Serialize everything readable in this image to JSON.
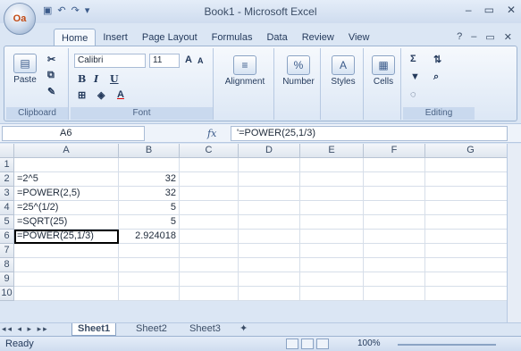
{
  "app": {
    "title": "Book1 - Microsoft Excel",
    "office_button_glyph": "Oa",
    "qat": [
      "save-icon",
      "undo-icon",
      "redo-icon"
    ],
    "window_controls": [
      "–",
      "▭",
      "✕"
    ]
  },
  "tabs": [
    "Home",
    "Insert",
    "Page Layout",
    "Formulas",
    "Data",
    "Review",
    "View"
  ],
  "ribbon": {
    "clipboard": {
      "paste": "Paste",
      "label": "Clipboard"
    },
    "font": {
      "name": "Calibri",
      "size": "11",
      "bold": "B",
      "italic": "I",
      "underline": "U",
      "grow": "A",
      "shrink": "A",
      "label": "Font"
    },
    "alignment": {
      "label": "Alignment"
    },
    "number": {
      "label": "Number",
      "glyph": "%"
    },
    "styles": {
      "label": "Styles"
    },
    "cells": {
      "label": "Cells"
    },
    "editing": {
      "label": "Editing",
      "sum": "Σ"
    }
  },
  "formula_bar": {
    "name_box": "A6",
    "fx": "fx",
    "formula": "'=POWER(25,1/3)"
  },
  "columns": [
    "A",
    "B",
    "C",
    "D",
    "E",
    "F",
    "G"
  ],
  "rows": [
    {
      "num": "1",
      "A": "",
      "B": ""
    },
    {
      "num": "2",
      "A": "=2^5",
      "B": "32"
    },
    {
      "num": "3",
      "A": "=POWER(2,5)",
      "B": "32"
    },
    {
      "num": "4",
      "A": "=25^(1/2)",
      "B": "5"
    },
    {
      "num": "5",
      "A": "=SQRT(25)",
      "B": "5"
    },
    {
      "num": "6",
      "A": "=POWER(25,1/3)",
      "B": "2.924018"
    },
    {
      "num": "7",
      "A": "",
      "B": ""
    },
    {
      "num": "8",
      "A": "",
      "B": ""
    },
    {
      "num": "9",
      "A": "",
      "B": ""
    },
    {
      "num": "10",
      "A": "",
      "B": ""
    }
  ],
  "sheets": [
    "Sheet1",
    "Sheet2",
    "Sheet3"
  ],
  "status": {
    "ready": "Ready",
    "zoom": "100%"
  }
}
